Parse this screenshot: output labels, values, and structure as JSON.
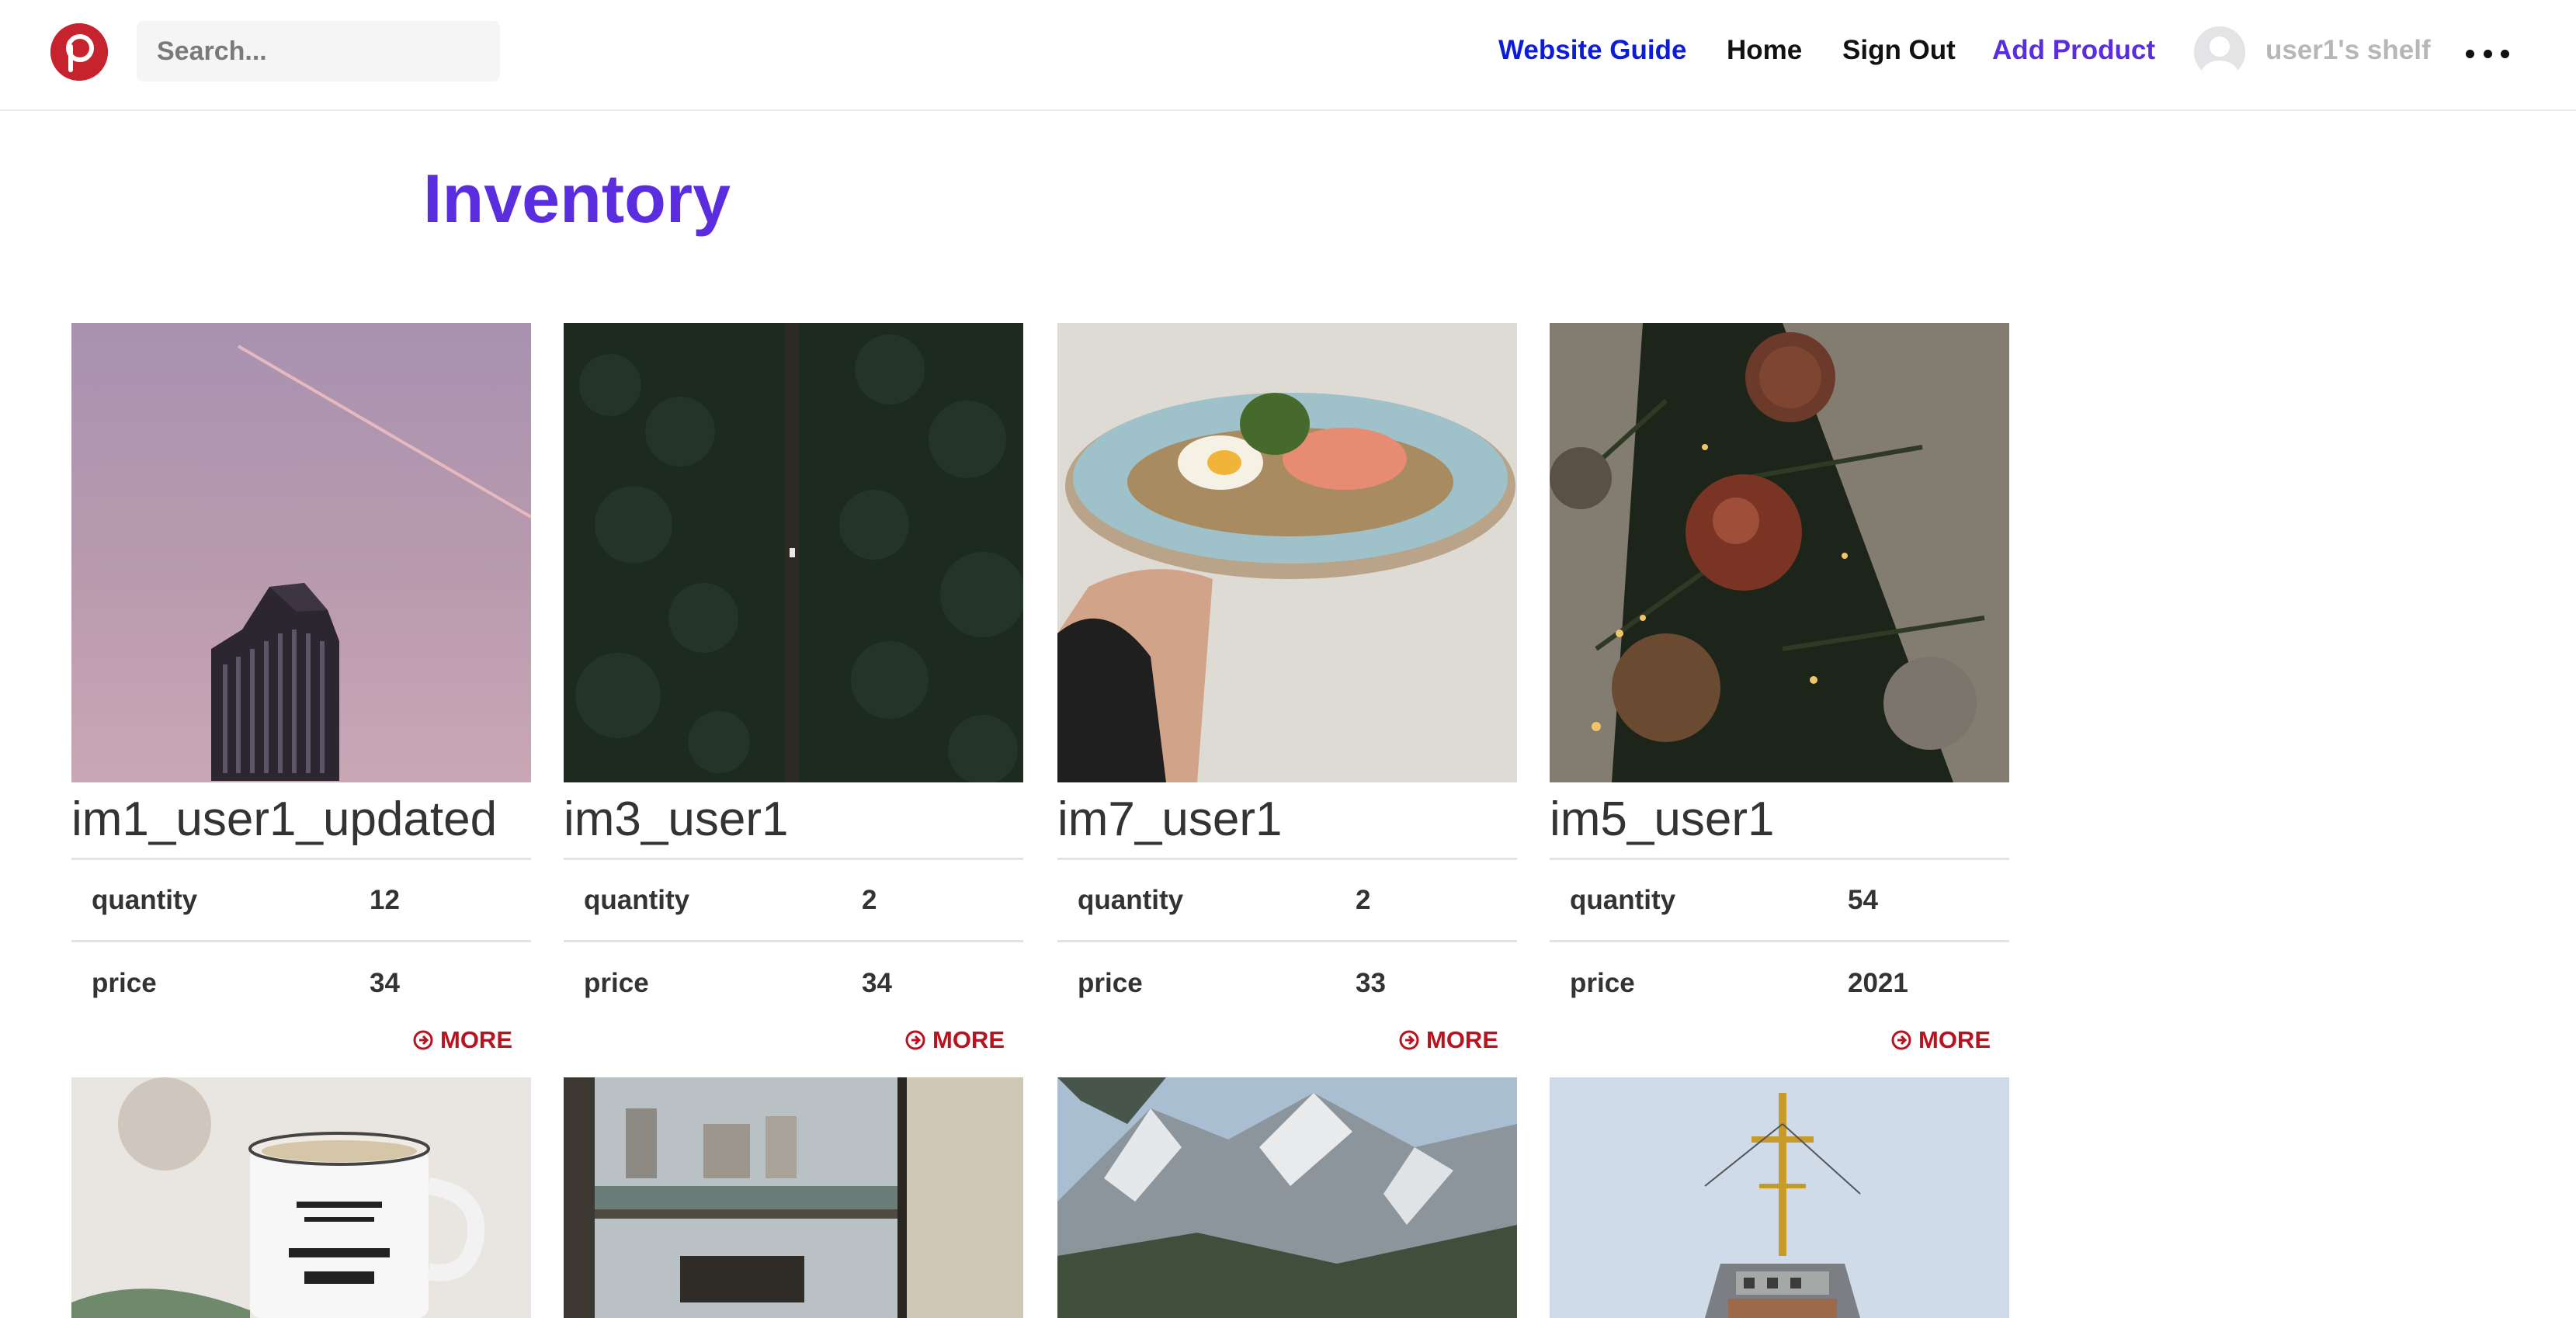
{
  "header": {
    "search_placeholder": "Search...",
    "nav": {
      "website_guide": "Website Guide",
      "home": "Home",
      "sign_out": "Sign Out",
      "add_product": "Add Product"
    },
    "shelf_label": "user1's shelf",
    "colors": {
      "logo": "#c7232e",
      "guide_link": "#0d1bdc",
      "add_product_link": "#5b2de0"
    }
  },
  "page": {
    "title": "Inventory",
    "title_color": "#5a2ddf"
  },
  "products": [
    {
      "name": "im1_user1_updated",
      "quantity_label": "quantity",
      "quantity": "12",
      "price_label": "price",
      "price": "34",
      "more_label": "MORE"
    },
    {
      "name": "im3_user1",
      "quantity_label": "quantity",
      "quantity": "2",
      "price_label": "price",
      "price": "34",
      "more_label": "MORE"
    },
    {
      "name": "im7_user1",
      "quantity_label": "quantity",
      "quantity": "2",
      "price_label": "price",
      "price": "33",
      "more_label": "MORE"
    },
    {
      "name": "im5_user1",
      "quantity_label": "quantity",
      "quantity": "54",
      "price_label": "price",
      "price": "2021",
      "more_label": "MORE"
    }
  ],
  "second_row_image_names": [
    "chocolate-mug-image",
    "balcony-room-image",
    "snowy-mountain-image",
    "ship-mast-image"
  ]
}
